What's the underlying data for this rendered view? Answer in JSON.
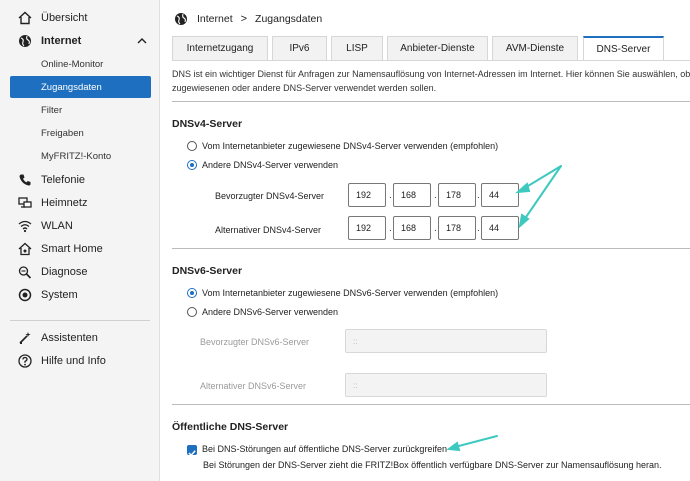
{
  "sidebar": {
    "items": [
      {
        "label": "Übersicht",
        "icon": "home-icon"
      },
      {
        "label": "Internet",
        "icon": "globe-icon"
      },
      {
        "label": "Telefonie",
        "icon": "phone-icon"
      },
      {
        "label": "Heimnetz",
        "icon": "network-icon"
      },
      {
        "label": "WLAN",
        "icon": "wifi-icon"
      },
      {
        "label": "Smart Home",
        "icon": "smart-home-icon"
      },
      {
        "label": "Diagnose",
        "icon": "diagnose-icon"
      },
      {
        "label": "System",
        "icon": "system-icon"
      },
      {
        "label": "Assistenten",
        "icon": "wizard-icon"
      },
      {
        "label": "Hilfe und Info",
        "icon": "help-icon"
      }
    ],
    "internet_sub": [
      {
        "label": "Online-Monitor"
      },
      {
        "label": "Zugangsdaten"
      },
      {
        "label": "Filter"
      },
      {
        "label": "Freigaben"
      },
      {
        "label": "MyFRITZ!-Konto"
      }
    ]
  },
  "breadcrumb": {
    "part1": "Internet",
    "separator": ">",
    "part2": "Zugangsdaten"
  },
  "tabs": [
    {
      "label": "Internetzugang"
    },
    {
      "label": "IPv6"
    },
    {
      "label": "LISP"
    },
    {
      "label": "Anbieter-Dienste"
    },
    {
      "label": "AVM-Dienste"
    },
    {
      "label": "DNS-Server"
    }
  ],
  "intro": {
    "line1": "DNS ist ein wichtiger Dienst für Anfragen zur Namensauflösung von Internet-Adressen im Internet. Hier können Sie auswählen, ob",
    "line2": "zugewiesenen oder andere DNS-Server verwendet werden sollen."
  },
  "dnsv4": {
    "title": "DNSv4-Server",
    "option_provider": "Vom Internetanbieter zugewiesene DNSv4-Server verwenden (empfohlen)",
    "option_other": "Andere DNSv4-Server verwenden",
    "preferred_label": "Bevorzugter DNSv4-Server",
    "preferred": [
      "192",
      "168",
      "178",
      "44"
    ],
    "alternate_label": "Alternativer DNSv4-Server",
    "alternate": [
      "192",
      "168",
      "178",
      "44"
    ],
    "separator": "."
  },
  "dnsv6": {
    "title": "DNSv6-Server",
    "option_provider": "Vom Internetanbieter zugewiesene DNSv6-Server verwenden (empfohlen)",
    "option_other": "Andere DNSv6-Server verwenden",
    "preferred_label": "Bevorzugter DNSv6-Server",
    "preferred_placeholder": "::",
    "alternate_label": "Alternativer DNSv6-Server",
    "alternate_placeholder": "::"
  },
  "public_dns": {
    "title": "Öffentliche DNS-Server",
    "checkbox_label": "Bei DNS-Störungen auf öffentliche DNS-Server zurückgreifen",
    "description": "Bei Störungen der DNS-Server zieht die FRITZ!Box öffentlich verfügbare DNS-Server zur Namensauflösung heran."
  },
  "colors": {
    "accent": "#1e6fbf",
    "annotation_arrow": "#3ec9c0"
  }
}
